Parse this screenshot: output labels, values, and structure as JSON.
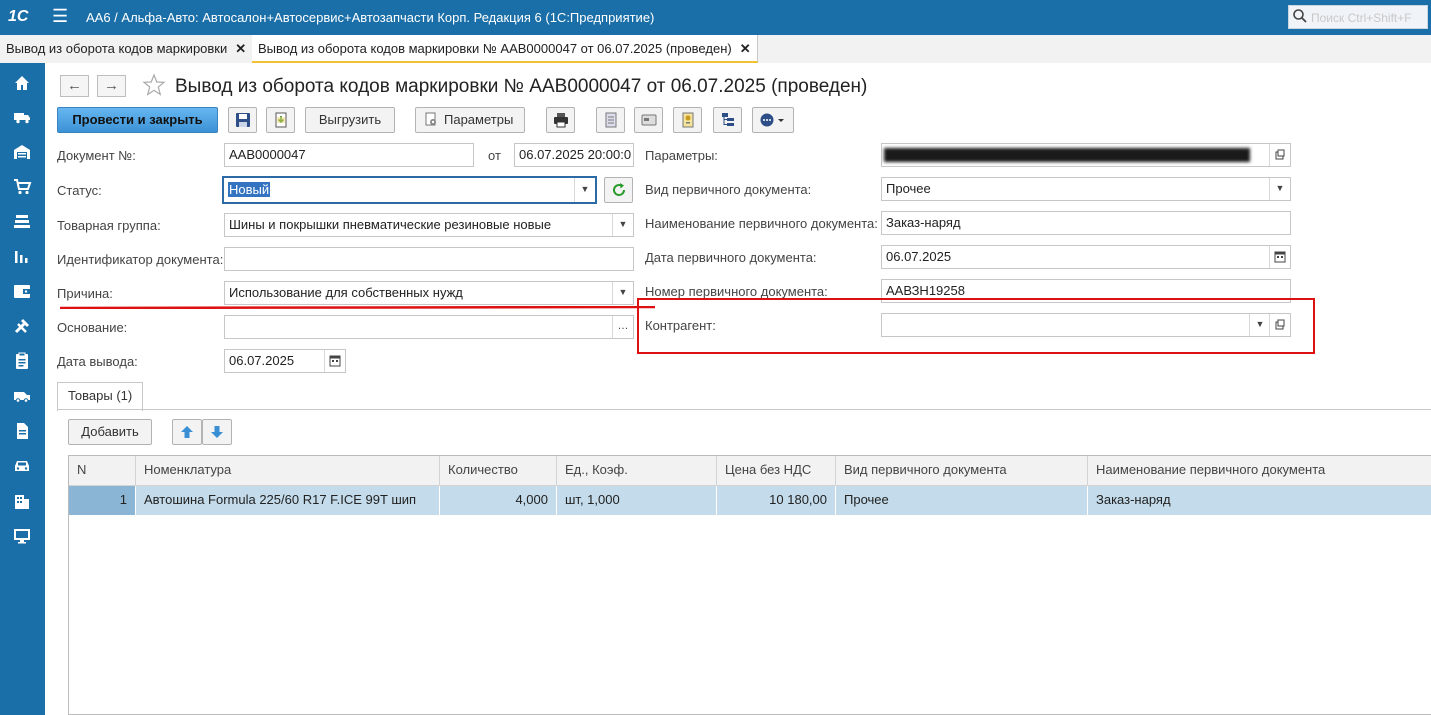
{
  "app": {
    "logo": "1С",
    "title": "АА6 / Альфа-Авто: Автосалон+Автосервис+Автозапчасти Корп. Редакция 6  (1С:Предприятие)",
    "search_placeholder": "Поиск Ctrl+Shift+F"
  },
  "tabs": [
    {
      "label": "Вывод из оборота кодов маркировки"
    },
    {
      "label": "Вывод из оборота кодов маркировки № ААВ0000047  от 06.07.2025 (проведен)"
    }
  ],
  "page": {
    "title": "Вывод из оборота кодов маркировки № ААВ0000047  от 06.07.2025 (проведен)"
  },
  "toolbar": {
    "post_close": "Провести и закрыть",
    "export": "Выгрузить",
    "params": "Параметры"
  },
  "form": {
    "doc_no_label": "Документ №:",
    "doc_no": "ААВ0000047",
    "from_label": "от",
    "date": "06.07.2025 20:00:0",
    "status_label": "Статус:",
    "status": "Новый",
    "group_label": "Товарная группа:",
    "group": "Шины и покрышки пневматические резиновые новые",
    "ident_label": "Идентификатор документа:",
    "ident": "",
    "reason_label": "Причина:",
    "reason": "Использование для собственных нужд",
    "basis_label": "Основание:",
    "basis": "",
    "out_date_label": "Дата вывода:",
    "out_date": "06.07.2025",
    "params_label": "Параметры:",
    "params_value": "",
    "prim_type_label": "Вид первичного документа:",
    "prim_type": "Прочее",
    "prim_name_label": "Наименование первичного документа:",
    "prim_name": "Заказ-наряд",
    "prim_date_label": "Дата первичного документа:",
    "prim_date": "06.07.2025",
    "prim_no_label": "Номер первичного документа:",
    "prim_no": "ААВЗН19258",
    "counterparty_label": "Контрагент:",
    "counterparty": ""
  },
  "goods_tab": {
    "label": "Товары (1)",
    "add": "Добавить"
  },
  "table": {
    "headers": [
      "N",
      "Номенклатура",
      "Количество",
      "Ед., Коэф.",
      "Цена без НДС",
      "Вид первичного документа",
      "Наименование первичного документа"
    ],
    "rows": [
      [
        "1",
        "Автошина Formula 225/60 R17 F.ICE 99T шип",
        "4,000",
        "шт, 1,000",
        "10 180,00",
        "Прочее",
        "Заказ-наряд"
      ]
    ]
  },
  "colors": {
    "header_blue": "#1b6fa8",
    "primary_button": "#4ea4e4",
    "selected_row": "#c3dbea",
    "annotation_red": "#dd1111"
  },
  "icons": {
    "sidebar": [
      "home-icon",
      "truck-icon",
      "warehouse-icon",
      "cart-icon",
      "stack-icon",
      "chart-icon",
      "wallet-icon",
      "tools-icon",
      "clipboard-icon",
      "van-icon",
      "document-icon",
      "car-icon",
      "building-icon",
      "monitor-icon"
    ]
  }
}
